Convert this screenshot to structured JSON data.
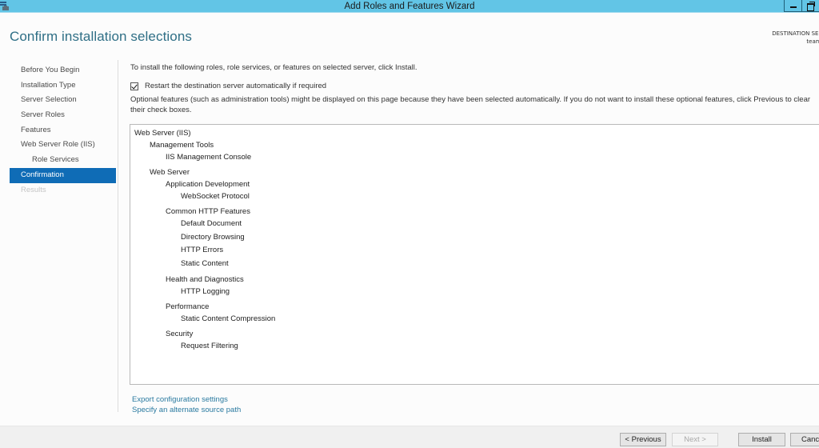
{
  "window": {
    "title": "Add Roles and Features Wizard",
    "app_icon": "server-manager-icon",
    "controls": [
      "minimize",
      "restore"
    ]
  },
  "header": {
    "page_title": "Confirm installation selections",
    "destination_label": "DESTINATION SERVER",
    "destination_name": "teamcityt"
  },
  "nav": {
    "items": [
      {
        "label": "Before You Begin",
        "state": "normal"
      },
      {
        "label": "Installation Type",
        "state": "normal"
      },
      {
        "label": "Server Selection",
        "state": "normal"
      },
      {
        "label": "Server Roles",
        "state": "normal"
      },
      {
        "label": "Features",
        "state": "normal"
      },
      {
        "label": "Web Server Role (IIS)",
        "state": "normal"
      },
      {
        "label": "Role Services",
        "state": "sub"
      },
      {
        "label": "Confirmation",
        "state": "active"
      },
      {
        "label": "Results",
        "state": "disabled"
      }
    ]
  },
  "content": {
    "intro": "To install the following roles, role services, or features on selected server, click Install.",
    "restart_label": "Restart the destination server automatically if required",
    "restart_checked": true,
    "optional_text": "Optional features (such as administration tools) might be displayed on this page because they have been selected automatically. If you do not want to install these optional features, click Previous to clear their check boxes."
  },
  "tree": [
    {
      "label": "Web Server (IIS)",
      "level": 0
    },
    {
      "label": "Management Tools",
      "level": 1
    },
    {
      "label": "IIS Management Console",
      "level": 2
    },
    {
      "label": "Web Server",
      "level": 1
    },
    {
      "label": "Application Development",
      "level": 2
    },
    {
      "label": "WebSocket Protocol",
      "level": 3
    },
    {
      "label": "Common HTTP Features",
      "level": 2
    },
    {
      "label": "Default Document",
      "level": 3
    },
    {
      "label": "Directory Browsing",
      "level": 3
    },
    {
      "label": "HTTP Errors",
      "level": 3
    },
    {
      "label": "Static Content",
      "level": 3
    },
    {
      "label": "Health and Diagnostics",
      "level": 2
    },
    {
      "label": "HTTP Logging",
      "level": 3
    },
    {
      "label": "Performance",
      "level": 2
    },
    {
      "label": "Static Content Compression",
      "level": 3
    },
    {
      "label": "Security",
      "level": 2
    },
    {
      "label": "Request Filtering",
      "level": 3
    }
  ],
  "links": {
    "export": "Export configuration settings",
    "alternate_source": "Specify an alternate source path"
  },
  "buttons": {
    "previous": "< Previous",
    "next": "Next >",
    "install": "Install",
    "cancel": "Cancel"
  },
  "colors": {
    "titlebar": "#62c5e6",
    "accent": "#0f6cb6",
    "link": "#2a7aa0",
    "page_title": "#2f6f86"
  }
}
